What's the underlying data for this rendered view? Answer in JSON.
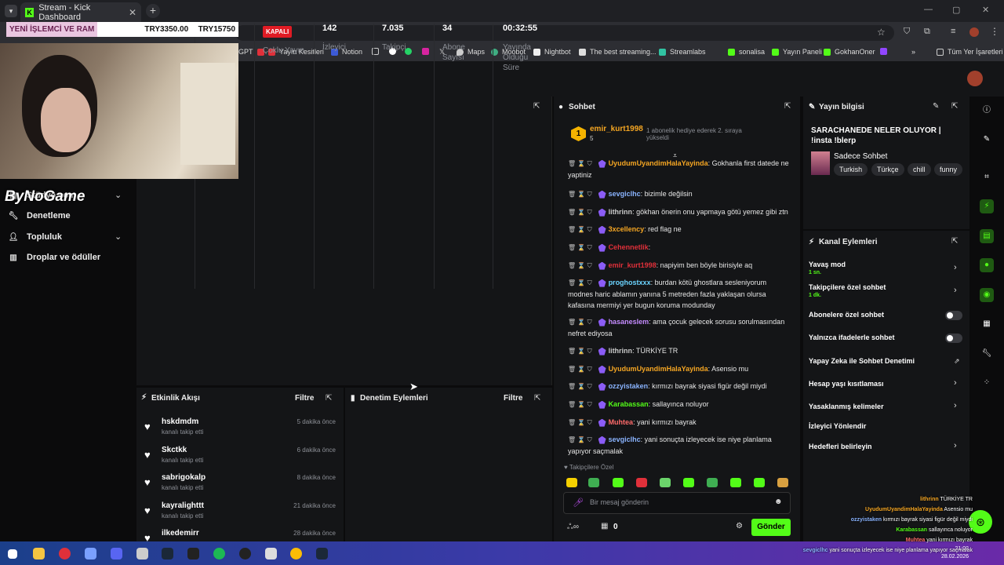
{
  "browser": {
    "tab_title": "Stream - Kick Dashboard",
    "bookmarks": [
      "GPT",
      "Yayın Kesitleri",
      "Notion",
      "Maps",
      "Moobot",
      "Nightbot",
      "The best streaming...",
      "Streamlabs",
      "sonalisa",
      "Yayın Paneli",
      "GokhanOner",
      "Tüm Yer İşaretleri"
    ]
  },
  "ticker": {
    "label": "YENİ İŞLEMCİ VE RAM",
    "price1": "TRY3350.00",
    "price2": "TRY15750"
  },
  "overlay_logo": "ByNoGame",
  "sidebar": {
    "items": [
      {
        "label": "Stüdyo.com",
        "icon": "studio-icon"
      },
      {
        "label": "Denetleme",
        "icon": "wrench-icon"
      },
      {
        "label": "Topluluk",
        "icon": "users-icon"
      },
      {
        "label": "Droplar ve ödüller",
        "icon": "gift-icon"
      }
    ]
  },
  "stats": {
    "status": "KAPALI",
    "multistream": "Çoklu Yayın",
    "viewers": {
      "value": "142",
      "label": "İzleyici"
    },
    "followers": {
      "value": "7.035",
      "label": "Takipçi"
    },
    "subs": {
      "value": "34",
      "label": "Abone Sayısı"
    },
    "uptime": {
      "value": "00:32:55",
      "label": "Yayında Olduğu Süre"
    }
  },
  "activity": {
    "title": "Etkinlik Akışı",
    "filter": "Filtre",
    "items": [
      {
        "name": "hskdmdm",
        "sub": "kanalı takip etti",
        "time": "5 dakika önce"
      },
      {
        "name": "Skctkk",
        "sub": "kanalı takip etti",
        "time": "6 dakika önce"
      },
      {
        "name": "sabrigokalp",
        "sub": "kanalı takip etti",
        "time": "8 dakika önce"
      },
      {
        "name": "kayralighttt",
        "sub": "kanalı takip etti",
        "time": "21 dakika önce"
      },
      {
        "name": "ilkedemirr",
        "sub": "",
        "time": "28 dakika önce"
      }
    ]
  },
  "moderation": {
    "title": "Denetim Eylemleri",
    "filter": "Filtre"
  },
  "chat": {
    "title": "Sohbet",
    "pinned_user": "emir_kurt1998",
    "pinned_count": "5",
    "pinned_text": "1 abonelik hediye ederek 2. sıraya yükseldi",
    "messages": [
      {
        "user": "UyudumUyandimHalaYayinda",
        "color": "#f5a623",
        "text": "Gokhanla first datede ne yaptiniz"
      },
      {
        "user": "sevgiclhc",
        "color": "#8ab4ff",
        "text": "bizimle değilsin"
      },
      {
        "user": "lithrinn",
        "color": "#c9c9c9",
        "text": "gökhan önerin onu yapmaya götü yemez gibi ztn"
      },
      {
        "user": "3xcellency",
        "color": "#f5a623",
        "text": "red flag ne"
      },
      {
        "user": "Cehennetlik",
        "color": "#e0303a",
        "text": ""
      },
      {
        "user": "emir_kurt1998",
        "color": "#e0303a",
        "text": "napiyim ben böyle birisiyle aq"
      },
      {
        "user": "proghostxxx",
        "color": "#6bd4ff",
        "text": "burdan kötü ghostlara sesleniyorum modnes haric ablamın yanına 5 metreden fazla yaklaşan olursa kafasına mermiyi yer bugun koruma modunday"
      },
      {
        "user": "hasaneslem",
        "color": "#c58cff",
        "text": "ama çocuk gelecek sorusu sorulmasından nefret ediyosa"
      },
      {
        "user": "lithrinn",
        "color": "#c9c9c9",
        "text": "TÜRKİYE TR"
      },
      {
        "user": "UyudumUyandimHalaYayinda",
        "color": "#f5a623",
        "text": "Asensio mu"
      },
      {
        "user": "ozzyistaken",
        "color": "#8ab4ff",
        "text": "kırmızı bayrak siyasi figür değil miydi"
      },
      {
        "user": "Karabassan",
        "color": "#53fc18",
        "text": "sallayınca noluyor"
      },
      {
        "user": "Muhtea",
        "color": "#ff6b6b",
        "text": "yani kırmızı bayrak"
      },
      {
        "user": "sevgiclhc",
        "color": "#8ab4ff",
        "text": "yani sonuçta izleyecek ise niye planlama yapıyor saçmalak"
      }
    ],
    "followers_only": "Takipçilere Özel",
    "input_placeholder": "Bir mesaj gönderin",
    "points": "0",
    "send_label": "Gönder"
  },
  "stream_info": {
    "title": "Yayın bilgisi",
    "stream_title": "SARACHANEDE NELER OLUYOR | !insta !blerp",
    "category": "Sadece Sohbet",
    "tags": [
      "Turkish",
      "Türkçe",
      "chill",
      "funny"
    ]
  },
  "channel_actions": {
    "title": "Kanal Eylemleri",
    "items": [
      {
        "label": "Yavaş mod",
        "sub": "1 sn.",
        "control": "chevron"
      },
      {
        "label": "Takipçilere özel sohbet",
        "sub": "1 dk.",
        "control": "chevron"
      },
      {
        "label": "Abonelere özel sohbet",
        "sub": "",
        "control": "toggle"
      },
      {
        "label": "Yalnızca ifadelerle sohbet",
        "sub": "",
        "control": "toggle"
      },
      {
        "label": "Yapay Zeka ile Sohbet Denetimi",
        "sub": "",
        "control": "external"
      },
      {
        "label": "Hesap yaşı kısıtlaması",
        "sub": "",
        "control": "chevron"
      },
      {
        "label": "Yasaklanmış kelimeler",
        "sub": "",
        "control": "chevron"
      },
      {
        "label": "İzleyici Yönlendir",
        "sub": "",
        "control": "none"
      },
      {
        "label": "Hedefleri belirleyin",
        "sub": "",
        "control": "chevron"
      }
    ]
  },
  "overlay_chat": [
    {
      "user": "lithrinn",
      "text": "TÜRKİYE TR"
    },
    {
      "user": "UyudumUyandimHalaYayinda",
      "text": "Asensio mu"
    },
    {
      "user": "ozzyistaken",
      "text": "kırmızı bayrak siyasi figür değil miydi"
    },
    {
      "user": "Karabassan",
      "text": "sallayınca noluyor"
    },
    {
      "user": "Muhtea",
      "text": "yani kırmızı bayrak"
    },
    {
      "user": "sevgiclhc",
      "text": "yani sonuçta izleyecek ise niye planlama yapıyor saçmalak"
    }
  ],
  "clock": {
    "time": "21:02",
    "date": "28.02.2026"
  },
  "colors": {
    "accent": "#53fc18",
    "live_red": "#e01b24",
    "panel": "#141517"
  }
}
